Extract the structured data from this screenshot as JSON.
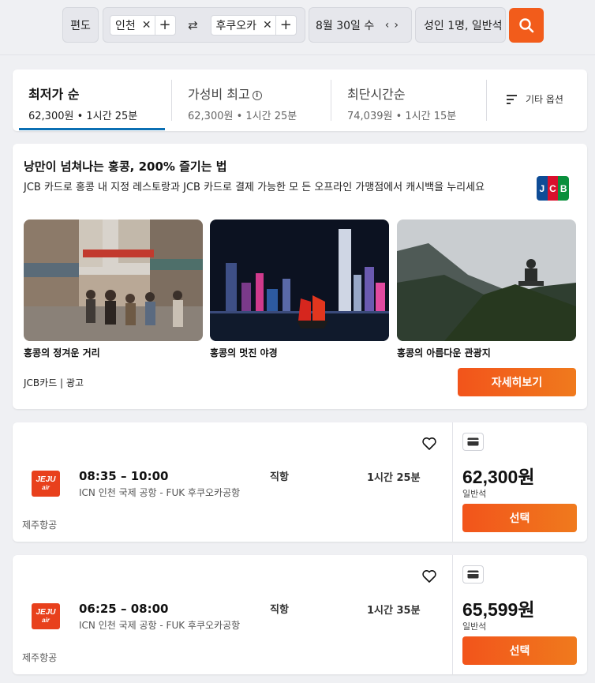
{
  "search": {
    "trip_type": "편도",
    "origin": "인천",
    "destination": "후쿠오카",
    "date": "8월 30일 수",
    "passengers": "성인 1명, 일반석"
  },
  "sort_tabs": [
    {
      "title": "최저가 순",
      "sub": "62,300원 • 1시간 25분",
      "active": true
    },
    {
      "title": "가성비 최고",
      "sub": "62,300원 • 1시간 25분",
      "active": false
    },
    {
      "title": "최단시간순",
      "sub": "74,039원 • 1시간 15분",
      "active": false
    }
  ],
  "more_options": "기타 옵션",
  "ad": {
    "title": "낭만이 넘쳐나는 홍콩, 200% 즐기는 법",
    "description": "JCB 카드로 홍콩 내 지정 레스토랑과 JCB 카드로 결제 가능한 모 든 오프라인 가맹점에서 캐시백을 누리세요",
    "logo_letters": [
      "J",
      "C",
      "B"
    ],
    "captions": [
      "홍콩의 정겨운 거리",
      "홍콩의 멋진 야경",
      "홍콩의 아름다운 관광지"
    ],
    "sponsor": "JCB카드 | 광고",
    "cta": "자세히보기"
  },
  "flights": [
    {
      "logo_l1": "JEJU",
      "logo_l2": "air",
      "time": "08:35 – 10:00",
      "route": "ICN 인천 국제 공항 - FUK 후쿠오카공항",
      "stops": "직항",
      "duration": "1시간 25분",
      "airline": "제주항공",
      "price": "62,300원",
      "cabin": "일반석",
      "select": "선택"
    },
    {
      "logo_l1": "JEJU",
      "logo_l2": "air",
      "time": "06:25 – 08:00",
      "route": "ICN 인천 국제 공항 - FUK 후쿠오카공항",
      "stops": "직항",
      "duration": "1시간 35분",
      "airline": "제주항공",
      "price": "65,599원",
      "cabin": "일반석",
      "select": "선택"
    }
  ],
  "colors": {
    "accent": "#f25c1b",
    "tab_underline": "#0b6fb3",
    "jeju_red": "#e8401c"
  }
}
